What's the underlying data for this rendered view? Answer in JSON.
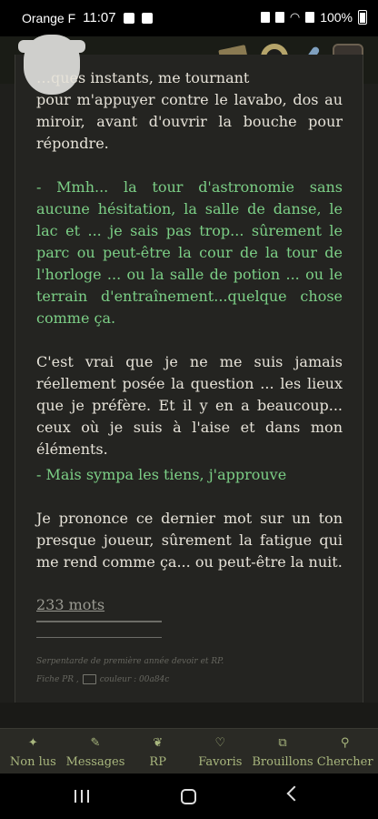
{
  "status": {
    "carrier": "Orange F",
    "time": "11:07",
    "battery": "100%"
  },
  "post": {
    "clipped_top": "…ques instants, me tournant",
    "p1": "pour m'appuyer contre le lavabo, dos au miroir, avant d'ouvrir la bouche pour répondre.",
    "p2": "- Mmh... la tour d'astronomie sans aucune hésitation, la salle de danse, le lac et ... je sais pas trop... sûrement le parc ou peut-être la cour de la tour de l'horloge ... ou la salle de potion ... ou le terrain d'entraînement...quelque chose comme ça.",
    "p3": "C'est vrai que je ne me suis jamais réellement posée la question ... les lieux que je préfère. Et il y en a beaucoup... ceux où je suis à l'aise et dans mon éléments.",
    "p4": "- Mais sympa les tiens, j'approuve",
    "p5": "Je prononce ce dernier mot sur un ton presque joueur, sûrement la fatigue qui me rend comme ça... ou peut-être la nuit.",
    "word_count": "233 mots",
    "signature_line1": "Serpentarde de première année devoir et RP.",
    "signature_fiche": "Fiche PR ,",
    "signature_color": "couleur : 00a84c"
  },
  "bottom_nav": [
    {
      "label": "Non lus",
      "icon": "sparkle-icon"
    },
    {
      "label": "Messages",
      "icon": "pen-icon"
    },
    {
      "label": "RP",
      "icon": "feather-icon"
    },
    {
      "label": "Favoris",
      "icon": "heart-icon"
    },
    {
      "label": "Brouillons",
      "icon": "drafts-icon"
    },
    {
      "label": "Chercher",
      "icon": "search-icon"
    }
  ],
  "colors": {
    "dialogue": "#7ccf86",
    "nav_accent": "#a9b77e",
    "panel": "#242421"
  }
}
